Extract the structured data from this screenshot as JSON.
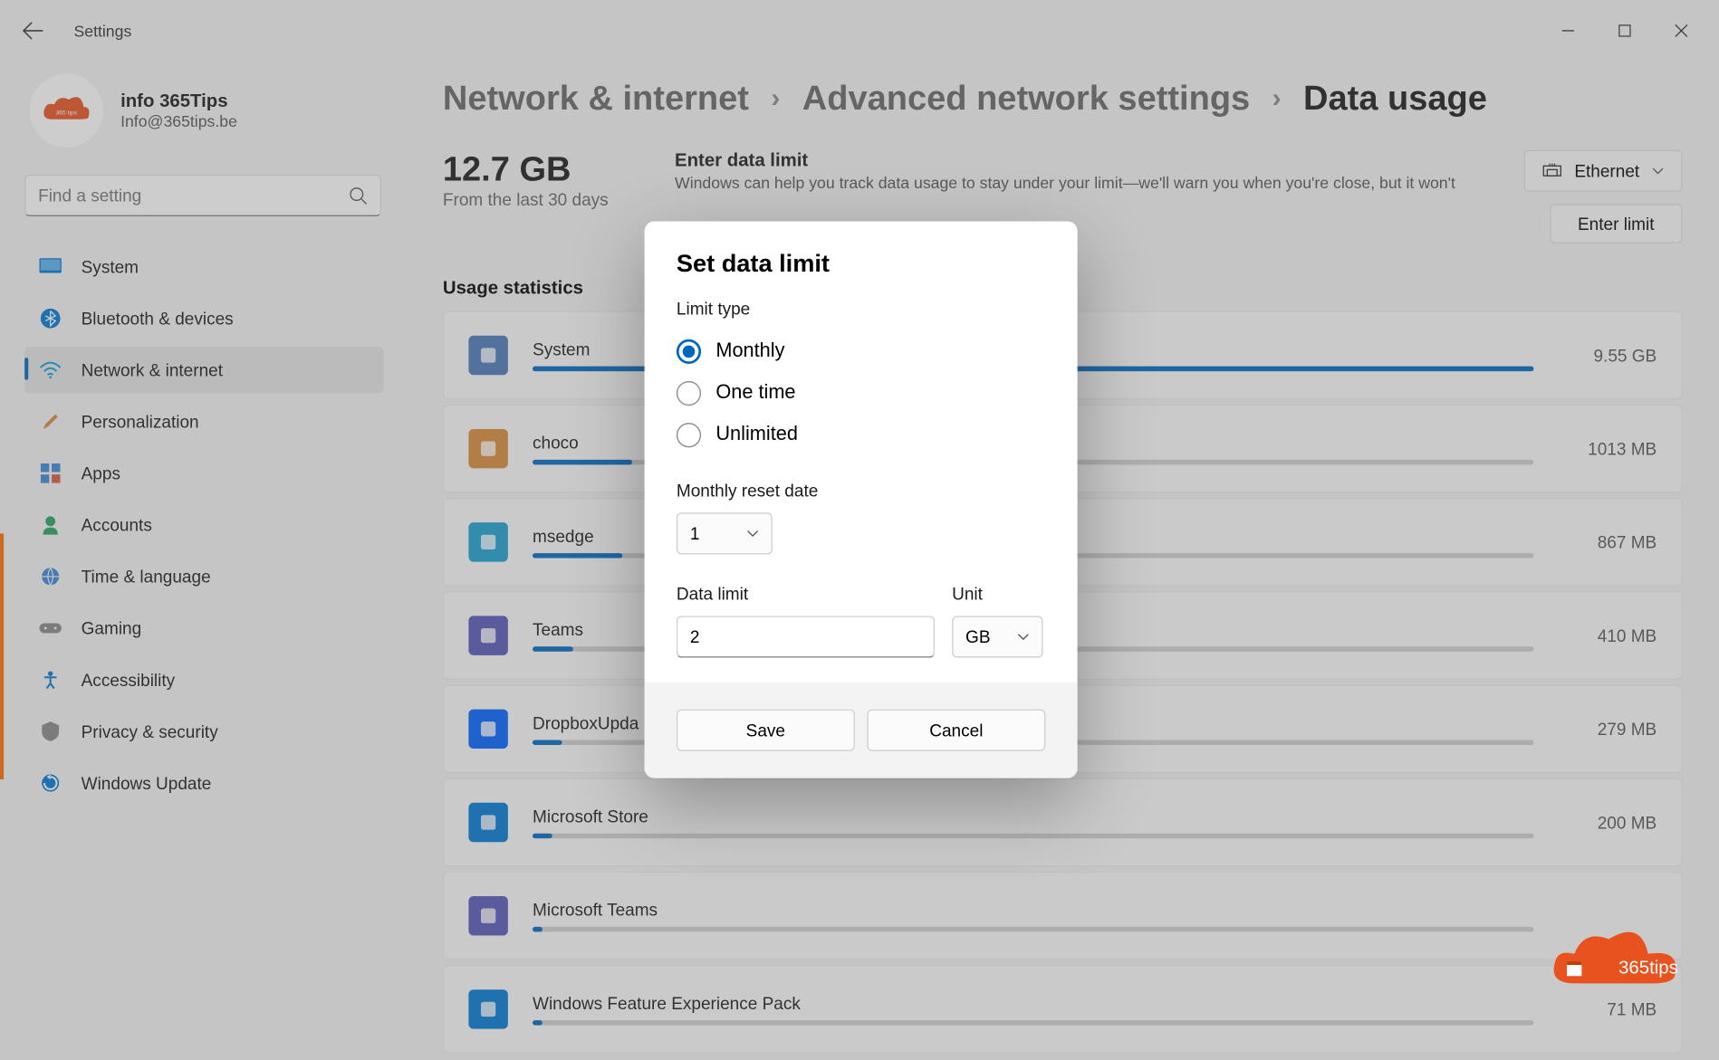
{
  "window": {
    "title": "Settings"
  },
  "profile": {
    "name": "info 365Tips",
    "email": "Info@365tips.be"
  },
  "search": {
    "placeholder": "Find a setting"
  },
  "nav": [
    {
      "label": "System",
      "active": false
    },
    {
      "label": "Bluetooth & devices",
      "active": false
    },
    {
      "label": "Network & internet",
      "active": true
    },
    {
      "label": "Personalization",
      "active": false
    },
    {
      "label": "Apps",
      "active": false
    },
    {
      "label": "Accounts",
      "active": false
    },
    {
      "label": "Time & language",
      "active": false
    },
    {
      "label": "Gaming",
      "active": false
    },
    {
      "label": "Accessibility",
      "active": false
    },
    {
      "label": "Privacy & security",
      "active": false
    },
    {
      "label": "Windows Update",
      "active": false
    }
  ],
  "breadcrumb": {
    "l1": "Network & internet",
    "l2": "Advanced network settings",
    "l3": "Data usage"
  },
  "summary": {
    "total": "12.7 GB",
    "period": "From the last 30 days",
    "limit_title": "Enter data limit",
    "limit_text": "Windows can help you track data usage to stay under your limit—we'll warn you when you're close, but it won't",
    "connection": "Ethernet",
    "enter_limit": "Enter limit"
  },
  "stats_title": "Usage statistics",
  "apps": [
    {
      "name": "System",
      "size": "9.55 GB",
      "pct": 100
    },
    {
      "name": "choco",
      "size": "1013 MB",
      "pct": 10
    },
    {
      "name": "msedge",
      "size": "867 MB",
      "pct": 9
    },
    {
      "name": "Teams",
      "size": "410 MB",
      "pct": 4
    },
    {
      "name": "DropboxUpda",
      "size": "279 MB",
      "pct": 3
    },
    {
      "name": "Microsoft Store",
      "size": "200 MB",
      "pct": 2
    },
    {
      "name": "Microsoft Teams",
      "size": "",
      "pct": 1
    },
    {
      "name": "Windows Feature Experience Pack",
      "size": "71 MB",
      "pct": 1
    }
  ],
  "modal": {
    "title": "Set data limit",
    "limit_type_label": "Limit type",
    "options": {
      "monthly": "Monthly",
      "onetime": "One time",
      "unlimited": "Unlimited"
    },
    "reset_label": "Monthly reset date",
    "reset_value": "1",
    "data_limit_label": "Data limit",
    "data_limit_value": "2",
    "unit_label": "Unit",
    "unit_value": "GB",
    "save": "Save",
    "cancel": "Cancel"
  },
  "brand": {
    "text": "365tips"
  }
}
